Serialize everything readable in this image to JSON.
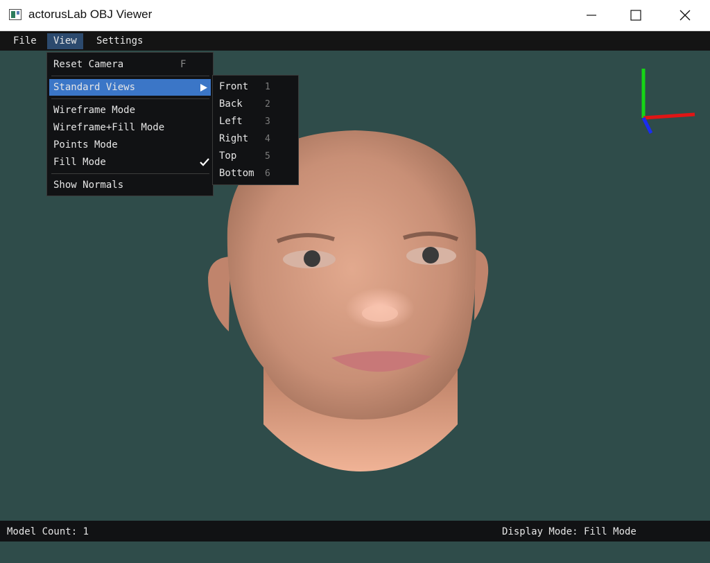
{
  "window": {
    "title": "actorusLab OBJ Viewer",
    "icons": {
      "app": "app-icon",
      "minimize": "minimize-icon",
      "maximize": "maximize-icon",
      "close": "close-icon"
    }
  },
  "menubar": {
    "file": "File",
    "view": "View",
    "settings": "Settings",
    "active": "View"
  },
  "view_menu": {
    "reset_camera": {
      "label": "Reset Camera",
      "shortcut": "F"
    },
    "standard_views": {
      "label": "Standard Views",
      "icon": "chevron-right-icon"
    },
    "wireframe": "Wireframe Mode",
    "wireframe_fill": "Wireframe+Fill Mode",
    "points": "Points Mode",
    "fill": {
      "label": "Fill Mode",
      "checked": true,
      "icon": "checkmark-icon"
    },
    "show_normals": "Show Normals"
  },
  "standard_views": [
    {
      "label": "Front",
      "key": "1"
    },
    {
      "label": "Back",
      "key": "2"
    },
    {
      "label": "Left",
      "key": "3"
    },
    {
      "label": "Right",
      "key": "4"
    },
    {
      "label": "Top",
      "key": "5"
    },
    {
      "label": "Bottom",
      "key": "6"
    }
  ],
  "viewport": {
    "background": "#2f4c4a",
    "axis_colors": {
      "x": "#e01515",
      "y": "#16d416",
      "z": "#1a2cf0"
    },
    "model": "head-model"
  },
  "status": {
    "model_count": "Model Count: 1",
    "display_mode": "Display Mode: Fill Mode"
  }
}
